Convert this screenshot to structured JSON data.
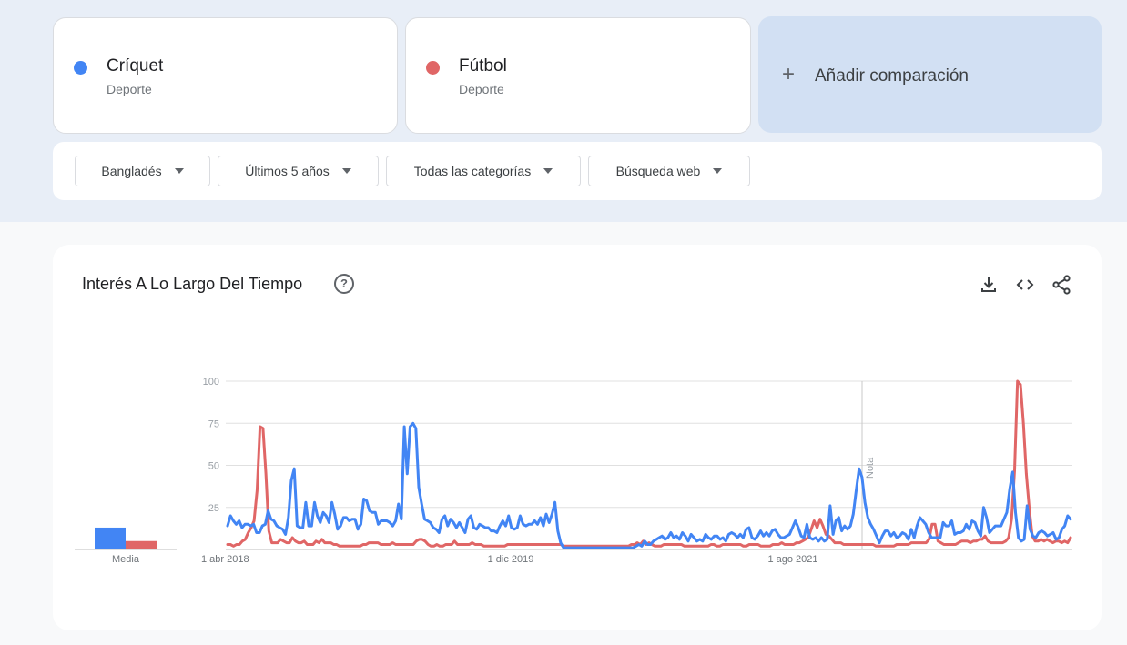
{
  "comparison": {
    "terms": [
      {
        "name": "Críquet",
        "type": "Deporte",
        "color": "#4285f4"
      },
      {
        "name": "Fútbol",
        "type": "Deporte",
        "color": "#e06666"
      }
    ],
    "add_label": "Añadir comparación"
  },
  "filters": {
    "region": "Bangladés",
    "period": "Últimos 5 años",
    "category": "Todas las categorías",
    "search_type": "Búsqueda web"
  },
  "chart_card": {
    "title": "Interés A Lo Largo Del Tiempo",
    "actions": [
      "download-icon",
      "embed-icon",
      "share-icon"
    ]
  },
  "chart_data": {
    "type": "line",
    "y_ticks": [
      "100",
      "75",
      "50",
      "25"
    ],
    "ylim": [
      0,
      100
    ],
    "x_tick_labels": [
      "1 abr 2018",
      "1 dic 2019",
      "1 ago 2021"
    ],
    "note_label": "Nota",
    "grid": true,
    "average": {
      "label": "Media",
      "values": [
        13,
        5
      ]
    },
    "series": [
      {
        "name": "Críquet",
        "color": "#4285f4",
        "values": [
          14,
          20,
          17,
          15,
          17,
          13,
          15,
          15,
          14,
          15,
          10,
          10,
          14,
          15,
          23,
          18,
          17,
          14,
          13,
          12,
          9,
          19,
          41,
          48,
          14,
          13,
          13,
          28,
          14,
          14,
          28,
          20,
          16,
          22,
          20,
          16,
          28,
          21,
          12,
          14,
          19,
          19,
          17,
          18,
          18,
          12,
          15,
          30,
          29,
          23,
          22,
          22,
          15,
          17,
          17,
          17,
          16,
          14,
          17,
          27,
          18,
          73,
          45,
          73,
          75,
          72,
          37,
          27,
          18,
          17,
          16,
          13,
          12,
          10,
          18,
          20,
          14,
          18,
          16,
          13,
          16,
          13,
          10,
          18,
          20,
          13,
          12,
          15,
          14,
          13,
          13,
          11,
          11,
          10,
          14,
          17,
          14,
          20,
          13,
          12,
          13,
          20,
          15,
          14,
          15,
          15,
          17,
          15,
          19,
          14,
          21,
          16,
          21,
          28,
          11,
          4,
          1,
          1,
          1,
          1,
          1,
          1,
          1,
          1,
          1,
          1,
          1,
          1,
          1,
          1,
          1,
          1,
          1,
          1,
          1,
          1,
          1,
          1,
          1,
          1,
          1,
          2,
          3,
          2,
          5,
          3,
          3,
          5,
          6,
          7,
          8,
          6,
          7,
          10,
          7,
          8,
          6,
          10,
          8,
          5,
          9,
          7,
          5,
          6,
          5,
          9,
          7,
          6,
          8,
          8,
          6,
          7,
          5,
          9,
          10,
          9,
          7,
          9,
          7,
          12,
          13,
          7,
          6,
          8,
          11,
          8,
          10,
          8,
          11,
          12,
          9,
          7,
          7,
          8,
          9,
          13,
          17,
          13,
          8,
          7,
          15,
          7,
          6,
          7,
          5,
          7,
          5,
          6,
          26,
          9,
          17,
          19,
          11,
          14,
          12,
          14,
          21,
          35,
          48,
          43,
          28,
          19,
          15,
          12,
          8,
          4,
          8,
          11,
          11,
          8,
          10,
          7,
          8,
          10,
          9,
          6,
          12,
          7,
          14,
          19,
          17,
          15,
          10,
          7,
          7,
          7,
          7,
          16,
          14,
          14,
          17,
          9,
          10,
          10,
          11,
          15,
          12,
          17,
          16,
          11,
          8,
          25,
          19,
          10,
          12,
          14,
          14,
          14,
          18,
          22,
          36,
          46,
          22,
          7,
          5,
          6,
          26,
          12,
          8,
          7,
          10,
          11,
          10,
          8,
          9,
          10,
          6,
          7,
          12,
          14,
          20,
          18
        ]
      },
      {
        "name": "Fútbol",
        "color": "#e06666",
        "values": [
          3,
          3,
          2,
          3,
          3,
          5,
          6,
          10,
          13,
          17,
          35,
          73,
          72,
          45,
          11,
          4,
          4,
          4,
          6,
          5,
          4,
          4,
          7,
          5,
          4,
          4,
          5,
          3,
          3,
          3,
          5,
          4,
          6,
          4,
          4,
          4,
          3,
          3,
          2,
          2,
          2,
          2,
          2,
          2,
          2,
          2,
          3,
          3,
          4,
          4,
          4,
          4,
          3,
          3,
          3,
          3,
          4,
          3,
          3,
          3,
          3,
          3,
          3,
          3,
          5,
          6,
          6,
          5,
          3,
          2,
          2,
          3,
          2,
          2,
          3,
          3,
          3,
          5,
          3,
          3,
          3,
          3,
          3,
          4,
          3,
          3,
          3,
          2,
          2,
          2,
          2,
          2,
          2,
          2,
          2,
          3,
          3,
          3,
          3,
          3,
          3,
          3,
          3,
          3,
          3,
          3,
          3,
          3,
          3,
          3,
          3,
          3,
          3,
          3,
          2,
          2,
          2,
          2,
          2,
          2,
          2,
          2,
          2,
          2,
          2,
          2,
          2,
          2,
          2,
          2,
          2,
          2,
          2,
          2,
          2,
          2,
          2,
          3,
          3,
          4,
          3,
          5,
          3,
          4,
          3,
          2,
          2,
          2,
          3,
          3,
          3,
          3,
          3,
          3,
          3,
          2,
          2,
          2,
          2,
          2,
          2,
          2,
          2,
          2,
          3,
          3,
          2,
          2,
          3,
          3,
          3,
          3,
          3,
          3,
          3,
          2,
          2,
          3,
          3,
          3,
          3,
          2,
          2,
          2,
          2,
          3,
          3,
          3,
          4,
          3,
          3,
          3,
          3,
          4,
          4,
          5,
          6,
          7,
          12,
          17,
          13,
          18,
          14,
          9,
          8,
          6,
          4,
          4,
          4,
          3,
          3,
          3,
          3,
          3,
          3,
          3,
          3,
          3,
          3,
          3,
          2,
          2,
          2,
          2,
          2,
          2,
          2,
          3,
          3,
          3,
          3,
          3,
          4,
          4,
          4,
          4,
          4,
          4,
          6,
          15,
          15,
          5,
          4,
          3,
          3,
          3,
          3,
          3,
          4,
          5,
          5,
          5,
          4,
          5,
          5,
          6,
          6,
          8,
          5,
          4,
          4,
          4,
          4,
          4,
          5,
          7,
          18,
          47,
          100,
          98,
          75,
          45,
          24,
          8,
          5,
          5,
          6,
          5,
          6,
          5,
          4,
          5,
          5,
          4,
          5,
          4,
          7
        ]
      }
    ]
  }
}
